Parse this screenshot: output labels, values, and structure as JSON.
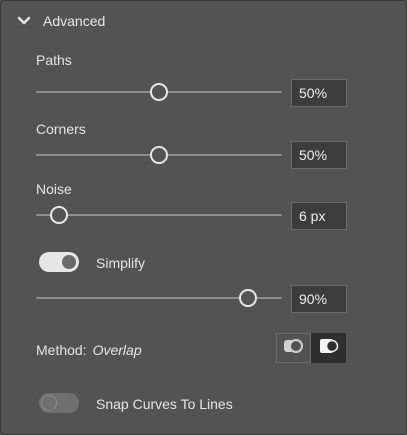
{
  "section": {
    "title": "Advanced",
    "expanded": true
  },
  "paths": {
    "label": "Paths",
    "value_text": "50%",
    "level": 0.5
  },
  "corners": {
    "label": "Corners",
    "value_text": "50%",
    "level": 0.5
  },
  "noise": {
    "label": "Noise",
    "value_text": "6 px",
    "level": 0.05
  },
  "simplify": {
    "label": "Simplify",
    "enabled": true,
    "value_text": "90%",
    "level": 0.9
  },
  "method": {
    "label": "Method:",
    "value": "Overlap",
    "options": [
      "abutting",
      "overlap"
    ],
    "selected": "overlap"
  },
  "snap": {
    "label": "Snap Curves To Lines",
    "enabled": false
  },
  "colors": {
    "panel_bg": "#535353",
    "field_bg": "#3c3c3c",
    "selected_btn_bg": "#2e2e2e",
    "text": "#e4e4e4"
  }
}
